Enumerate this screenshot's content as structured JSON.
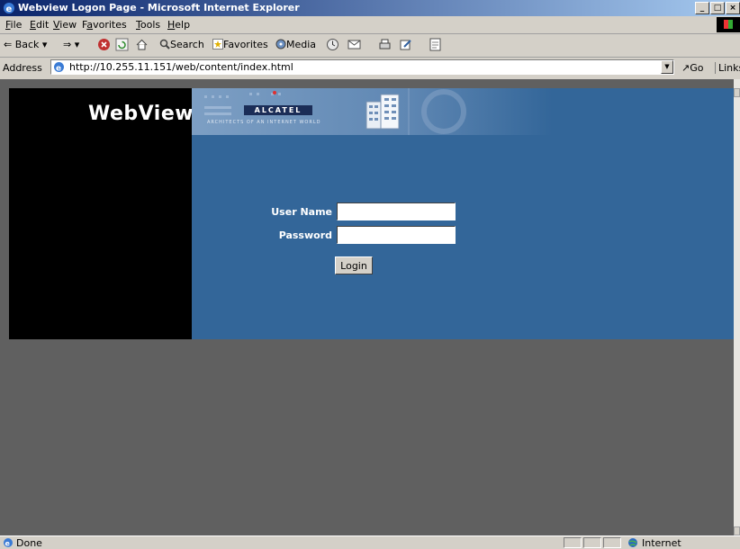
{
  "window": {
    "title": "Webview Logon Page - Microsoft Internet Explorer",
    "controls": [
      "_",
      "□",
      "×"
    ]
  },
  "menu": [
    "File",
    "Edit",
    "View",
    "Favorites",
    "Tools",
    "Help"
  ],
  "menu_mnemonics": [
    "F",
    "E",
    "V",
    "a",
    "T",
    "H"
  ],
  "toolbar": {
    "back": "Back",
    "search": "Search",
    "favorites": "Favorites",
    "media": "Media"
  },
  "address": {
    "label": "Address",
    "url": "http://10.255.11.151/web/content/index.html",
    "go": "Go",
    "links": "Links"
  },
  "page": {
    "brand": "WebView",
    "banner_logo": "ALCATEL",
    "banner_tagline": "ARCHITECTS OF AN INTERNET WORLD",
    "username_label": "User Name",
    "password_label": "Password",
    "username_value": "",
    "password_value": "",
    "login_button": "Login"
  },
  "status": {
    "text": "Done",
    "zone": "Internet"
  },
  "colors": {
    "page_blue": "#336699",
    "page_gray": "#606060",
    "left_panel": "#000000"
  }
}
